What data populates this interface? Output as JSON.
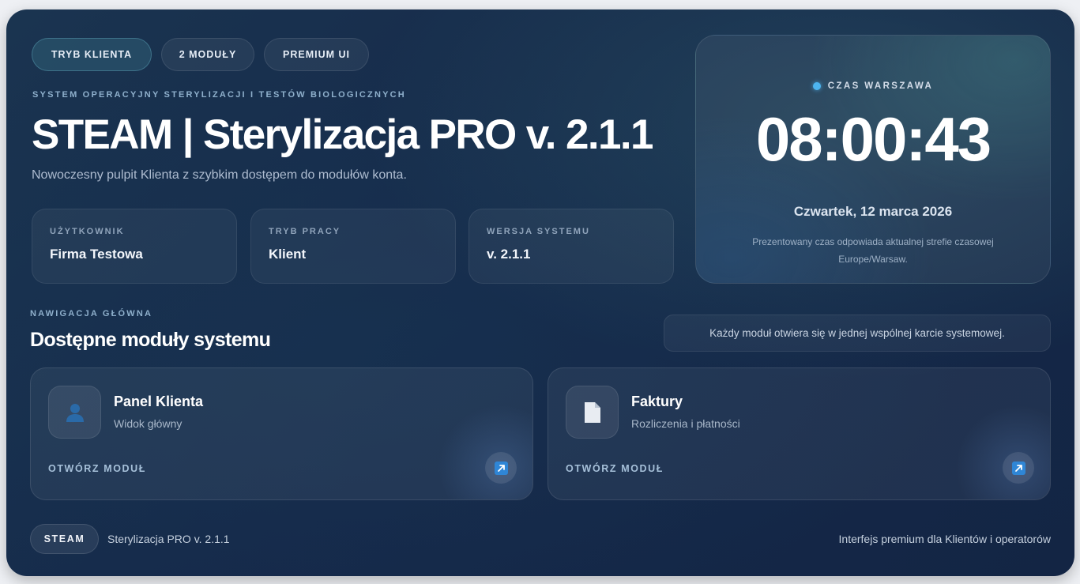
{
  "header": {
    "tags": [
      "TRYB KLIENTA",
      "2 MODUŁY",
      "PREMIUM UI"
    ],
    "eyebrow": "SYSTEM OPERACYJNY STERYLIZACJI I TESTÓW BIOLOGICZNYCH",
    "title": "STEAM | Sterylizacja PRO v. 2.1.1",
    "subtitle": "Nowoczesny pulpit Klienta z szybkim dostępem do modułów konta."
  },
  "info": [
    {
      "label": "UŻYTKOWNIK",
      "value": "Firma Testowa"
    },
    {
      "label": "TRYB PRACY",
      "value": "Klient"
    },
    {
      "label": "WERSJA SYSTEMU",
      "value": "v. 2.1.1"
    }
  ],
  "clock": {
    "label": "CZAS WARSZAWA",
    "time": "08:00:43",
    "date": "Czwartek, 12 marca 2026",
    "note": "Prezentowany czas odpowiada aktualnej strefie czasowej Europe/Warsaw.",
    "dot_color": "#4db5f0"
  },
  "navigation": {
    "eyebrow": "NAWIGACJA GŁÓWNA",
    "title": "Dostępne moduły systemu",
    "hint": "Każdy moduł otwiera się w jednej wspólnej karcie systemowej."
  },
  "modules": [
    {
      "title": "Panel Klienta",
      "subtitle": "Widok główny",
      "action": "OTWÓRZ MODUŁ",
      "icon": "user-icon"
    },
    {
      "title": "Faktury",
      "subtitle": "Rozliczenia i płatności",
      "action": "OTWÓRZ MODUŁ",
      "icon": "document-icon"
    }
  ],
  "footer": {
    "badge": "STEAM",
    "left": "Sterylizacja PRO v. 2.1.1",
    "right": "Interfejs premium dla Klientów i operatorów"
  },
  "colors": {
    "background": "#15294a",
    "accent": "#2f86d6"
  }
}
